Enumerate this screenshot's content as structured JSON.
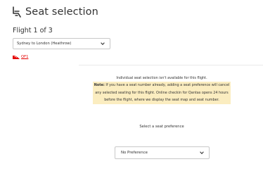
{
  "header": {
    "title": "Seat selection",
    "icon": "seat-icon"
  },
  "flight": {
    "label": "Flight 1 of 3",
    "selected_route": "Sydney to London (Heathrow)",
    "airline_logo_icon": "qantas-logo-icon",
    "airline_code": "QF1"
  },
  "notice": {
    "line1": "Individual seat selection isn't available for this flight.",
    "note_label": "Note:",
    "highlight_text": " If you have a seat number already, adding a seat preference will cancel any selected seating for this flight. Online checkin for Qantas opens 24 hours before the flight, where we display the seat map and seat number."
  },
  "preference": {
    "label": "Select a seat preference",
    "selected": "No Preference"
  },
  "colors": {
    "accent": "#e40000",
    "highlight": "#fbedc0",
    "text": "#323232"
  }
}
